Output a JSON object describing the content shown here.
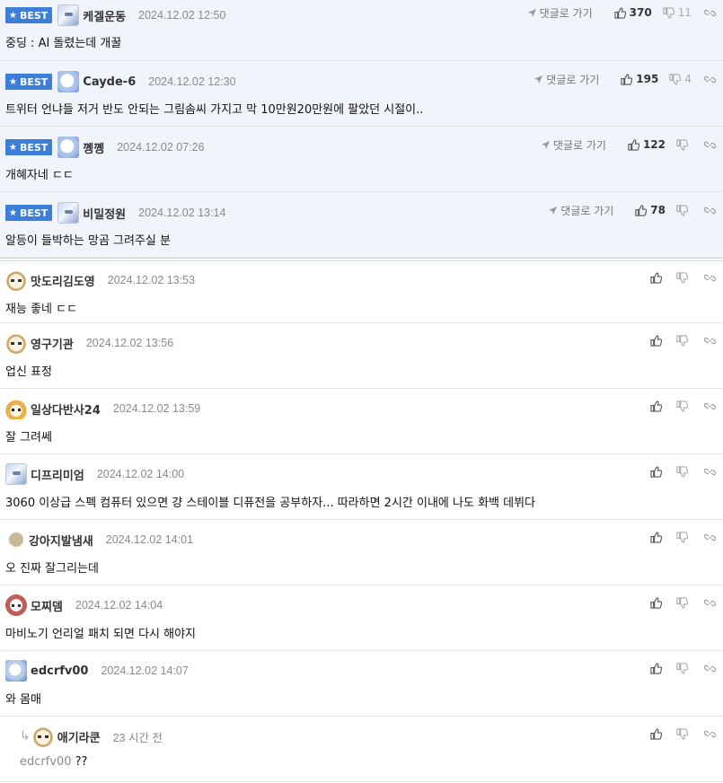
{
  "best_label": "BEST",
  "goto_label": "댓글로 가기",
  "best_comments": [
    {
      "nick": "케겔운동",
      "date": "2024.12.02 12:50",
      "text": "중딩 : AI 돌렸는데 개꿀",
      "up": "370",
      "down": "11",
      "avatar": "robot-avatar"
    },
    {
      "nick": "Cayde-6",
      "date": "2024.12.02 12:30",
      "text": "트위터 언냐들 저거 반도 안되는 그림솜씨 가지고 막 10만원20만원에 팔았던 시절이..",
      "up": "195",
      "down": "4",
      "avatar": "ghost-avatar"
    },
    {
      "nick": "꼥꼥",
      "date": "2024.12.02 07:26",
      "text": "개혜자네 ㄷㄷ",
      "up": "122",
      "down": "",
      "avatar": "ghost-avatar"
    },
    {
      "nick": "비밀정원",
      "date": "2024.12.02 13:14",
      "text": "알등이 들박하는 망곰 그려주실 분",
      "up": "78",
      "down": "",
      "avatar": "robot-avatar"
    }
  ],
  "comments": [
    {
      "nick": "맛도리김도영",
      "date": "2024.12.02 13:53",
      "text": "재능 좋네 ㄷㄷ",
      "avatar": "puppy-avatar"
    },
    {
      "nick": "영구기관",
      "date": "2024.12.02 13:56",
      "text": "업신 표정",
      "avatar": "puppy-avatar"
    },
    {
      "nick": "일상다반사24",
      "date": "2024.12.02 13:59",
      "text": "잘 그려쎄",
      "avatar": "fox-avatar"
    },
    {
      "nick": "디프리미엄",
      "date": "2024.12.02 14:00",
      "text": "3060 이상급 스펙 컴퓨터 있으면 걍 스테이블 디퓨전을 공부하자... 따라하면 2시간 이내에 나도 화백 데뷔다",
      "avatar": "robot-avatar"
    },
    {
      "nick": "강아지발냄새",
      "date": "2024.12.02 14:01",
      "text": "오 진짜 잘그리는데",
      "avatar": "dot-avatar"
    },
    {
      "nick": "모찌뎀",
      "date": "2024.12.02 14:04",
      "text": "마비노기 언리얼 패치 되면 다시 해야지",
      "avatar": "dog-avatar"
    },
    {
      "nick": "edcrfv00",
      "date": "2024.12.02 14:07",
      "text": "와 몸매",
      "avatar": "blue-avatar"
    }
  ],
  "reply": {
    "nick": "애기라쿤",
    "date": "23 시간 전",
    "mention": "edcrfv00",
    "text": "??",
    "avatar": "puppy-avatar"
  }
}
